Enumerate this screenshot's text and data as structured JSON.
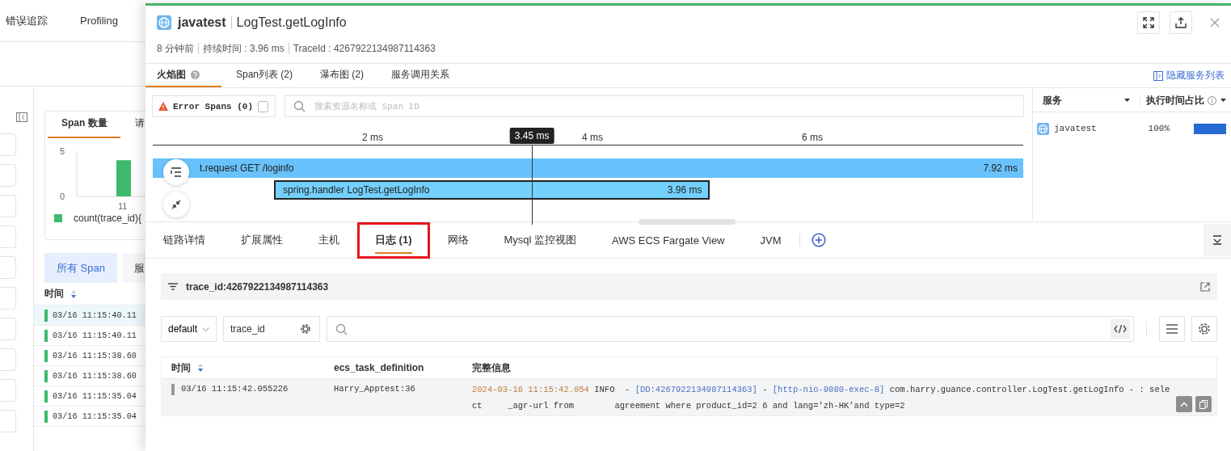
{
  "background_page": {
    "nav": [
      "错误追踪",
      "Profiling"
    ],
    "chart_card": {
      "tabs": [
        {
          "label": "Span 数量",
          "selected": true
        },
        {
          "label": "请",
          "selected": false
        }
      ],
      "chart_data": {
        "type": "bar",
        "categories": [
          "11"
        ],
        "yticks": [
          0,
          5
        ],
        "ylim": [
          0,
          5
        ],
        "series": [
          {
            "name": "count(trace_id){",
            "color": "#3dba6c",
            "values": [
              4
            ]
          }
        ]
      }
    },
    "span_tabs": [
      {
        "label": "所有 Span",
        "selected": true
      },
      {
        "label": "服",
        "selected": false
      }
    ],
    "table": {
      "columns": [
        "时间"
      ],
      "rows": [
        {
          "time": "03/16 11:15:40.11",
          "selected": true
        },
        {
          "time": "03/16 11:15:40.11",
          "selected": false
        },
        {
          "time": "03/16 11:15:38.60",
          "selected": false
        },
        {
          "time": "03/16 11:15:38.60",
          "selected": false
        },
        {
          "time": "03/16 11:15:35.04",
          "selected": false
        },
        {
          "time": "03/16 11:15:35.04",
          "selected": false
        }
      ]
    }
  },
  "drawer": {
    "header": {
      "service": "javatest",
      "resource": "LogTest.getLogInfo"
    },
    "meta": [
      "8 分钟前",
      "持续时间 : 3.96 ms",
      "TraceId : 4267922134987114363"
    ],
    "view_tabs": [
      {
        "label": "火焰图",
        "selected": true,
        "help": true
      },
      {
        "label": "Span列表 (2)",
        "selected": false,
        "help": false
      },
      {
        "label": "瀑布图 (2)",
        "selected": false,
        "help": false
      },
      {
        "label": "服务调用关系",
        "selected": false,
        "help": false
      }
    ],
    "hide_services_link": "隐藏服务列表",
    "flame": {
      "error_filter": {
        "label": "Error Spans (0)",
        "checked": false
      },
      "search": {
        "placeholder": "搜索资源名称或 Span ID"
      },
      "axis_ticks": [
        "2 ms",
        "4 ms",
        "6 ms"
      ],
      "cursor": "3.45 ms",
      "spans": [
        {
          "label": "t.request GET /loginfo",
          "duration": "7.92 ms",
          "selected": false,
          "children": [
            {
              "label": "spring.handler LogTest.getLogInfo",
              "duration": "3.96 ms",
              "selected": true
            }
          ]
        }
      ]
    },
    "services": {
      "columns": [
        "服务",
        "执行时间占比"
      ],
      "rows": [
        {
          "name": "javatest",
          "share": "100%",
          "level": 1
        }
      ]
    },
    "detail_tabs": [
      {
        "label": "链路详情",
        "selected": false,
        "highlighted": false
      },
      {
        "label": "扩展属性",
        "selected": false,
        "highlighted": false
      },
      {
        "label": "主机",
        "selected": false,
        "highlighted": false
      },
      {
        "label": "日志 (1)",
        "selected": true,
        "highlighted": true
      },
      {
        "label": "网络",
        "selected": false,
        "highlighted": false
      },
      {
        "label": "Mysql 监控视图",
        "selected": false,
        "highlighted": false
      },
      {
        "label": "AWS ECS Fargate View",
        "selected": false,
        "highlighted": false
      },
      {
        "label": "JVM",
        "selected": false,
        "highlighted": false
      }
    ],
    "logs": {
      "filter": "trace_id:4267922134987114363",
      "index": "default",
      "field": "trace_id",
      "columns": [
        {
          "label": "时间",
          "sortable": true
        },
        {
          "label": "ecs_task_definition",
          "sortable": false
        },
        {
          "label": "完整信息",
          "sortable": false
        }
      ],
      "rows": [
        {
          "time": "03/16 11:15:42.055226",
          "task": "Harry_Apptest:36",
          "message": [
            [
              {
                "kind": "time",
                "text": "2024-03-16 11:15:42.054"
              },
              {
                "kind": "plain",
                "text": " INFO  - "
              },
              {
                "kind": "ref",
                "text": "[DD:4267922134987114363]"
              },
              {
                "kind": "plain",
                "text": " - "
              },
              {
                "kind": "ref",
                "text": "[http-nio-9080-exec-8]"
              },
              {
                "kind": "plain",
                "text": " com.harry.guance.controller.LogTest.getLogInfo - : sele"
              }
            ],
            [
              {
                "kind": "plain",
                "text": "ct     _agr-url from        agreement where product_id=2 6 and lang='zh-HK’and type=2"
              }
            ]
          ]
        }
      ]
    }
  }
}
